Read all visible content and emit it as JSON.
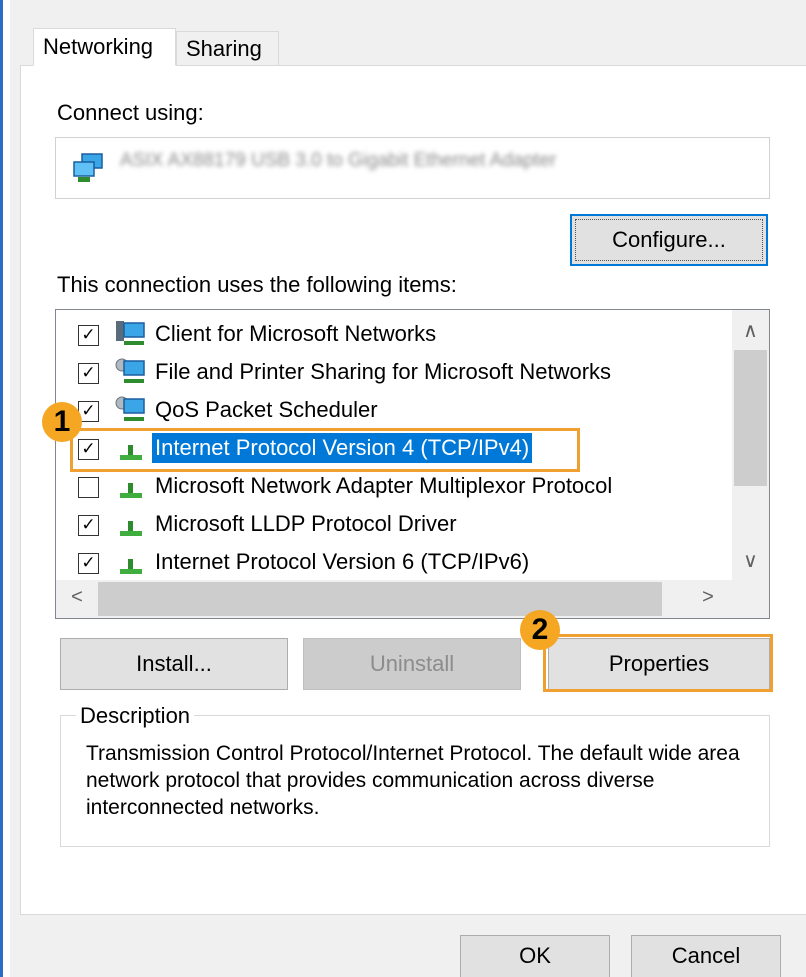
{
  "tabs": [
    {
      "label": "Networking",
      "active": true
    },
    {
      "label": "Sharing",
      "active": false
    }
  ],
  "connect_using": {
    "label": "Connect using:",
    "adapter_name": "ASIX AX88179 USB 3.0 to Gigabit Ethernet Adapter",
    "configure_button": "Configure..."
  },
  "items_section": {
    "label": "This connection uses the following items:",
    "items": [
      {
        "label": "Client for Microsoft Networks",
        "checked": true,
        "icon": "network-client-icon"
      },
      {
        "label": "File and Printer Sharing for Microsoft Networks",
        "checked": true,
        "icon": "network-service-icon"
      },
      {
        "label": "QoS Packet Scheduler",
        "checked": true,
        "icon": "network-service-icon"
      },
      {
        "label": "Internet Protocol Version 4 (TCP/IPv4)",
        "checked": true,
        "selected": true,
        "icon": "protocol-icon"
      },
      {
        "label": "Microsoft Network Adapter Multiplexor Protocol",
        "checked": false,
        "icon": "protocol-icon"
      },
      {
        "label": "Microsoft LLDP Protocol Driver",
        "checked": true,
        "icon": "protocol-icon"
      },
      {
        "label": "Internet Protocol Version 6 (TCP/IPv6)",
        "checked": true,
        "icon": "protocol-icon"
      }
    ]
  },
  "buttons": {
    "install": "Install...",
    "uninstall": "Uninstall",
    "properties": "Properties",
    "ok": "OK",
    "cancel": "Cancel"
  },
  "description": {
    "legend": "Description",
    "text": "Transmission Control Protocol/Internet Protocol. The default wide area network protocol that provides communication across diverse interconnected networks."
  },
  "annotations": {
    "step1": "1",
    "step2": "2",
    "highlight_color": "#f0a030"
  },
  "colors": {
    "selection": "#0078d7",
    "focus_border": "#0078d7"
  }
}
